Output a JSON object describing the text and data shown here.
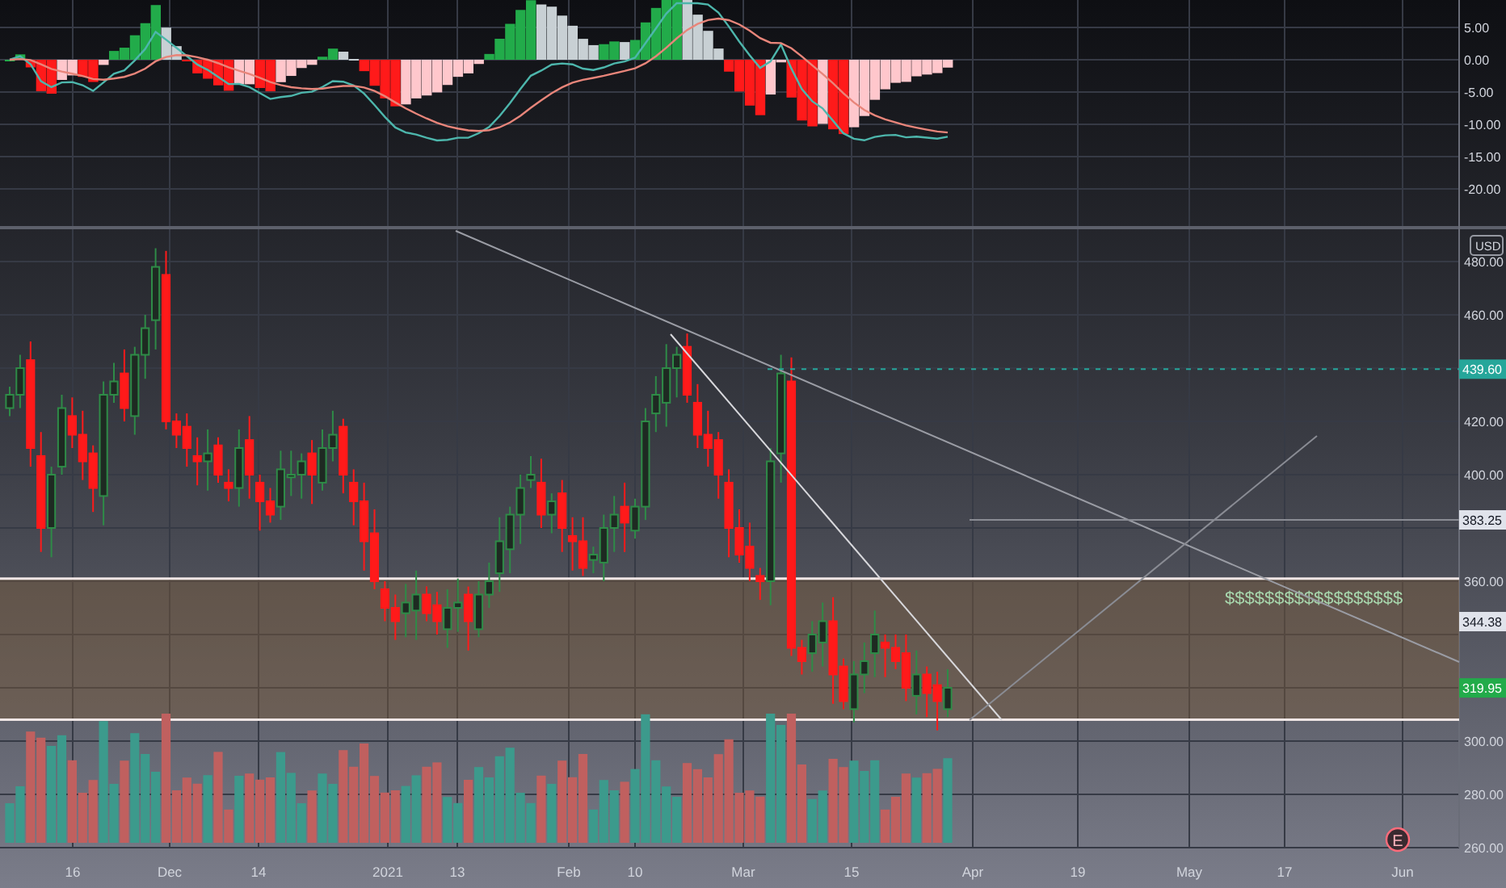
{
  "macd_pane": {
    "axis_ticks": [
      "5.00",
      "0.00",
      "-5.00",
      "-10.00",
      "-15.00",
      "-20.00"
    ]
  },
  "price_pane": {
    "currency": "USD",
    "axis_ticks": [
      "480.00",
      "460.00",
      "420.00",
      "400.00",
      "360.00",
      "300.00",
      "280.00",
      "260.00"
    ],
    "price_badges": [
      {
        "text": "439.60",
        "color": "#26a69a"
      },
      {
        "text": "383.25",
        "color": "#e0e3eb"
      },
      {
        "text": "344.38",
        "color": "#e0e3eb"
      },
      {
        "text": "319.95",
        "color": "#22ab4a"
      }
    ],
    "zone_marks": "$$$$$$$$$$$$$$$$$$",
    "earnings_marker": "E"
  },
  "time_axis": [
    "16",
    "Dec",
    "14",
    "2021",
    "13",
    "Feb",
    "10",
    "Mar",
    "15",
    "Apr",
    "19",
    "May",
    "17",
    "Jun"
  ]
}
